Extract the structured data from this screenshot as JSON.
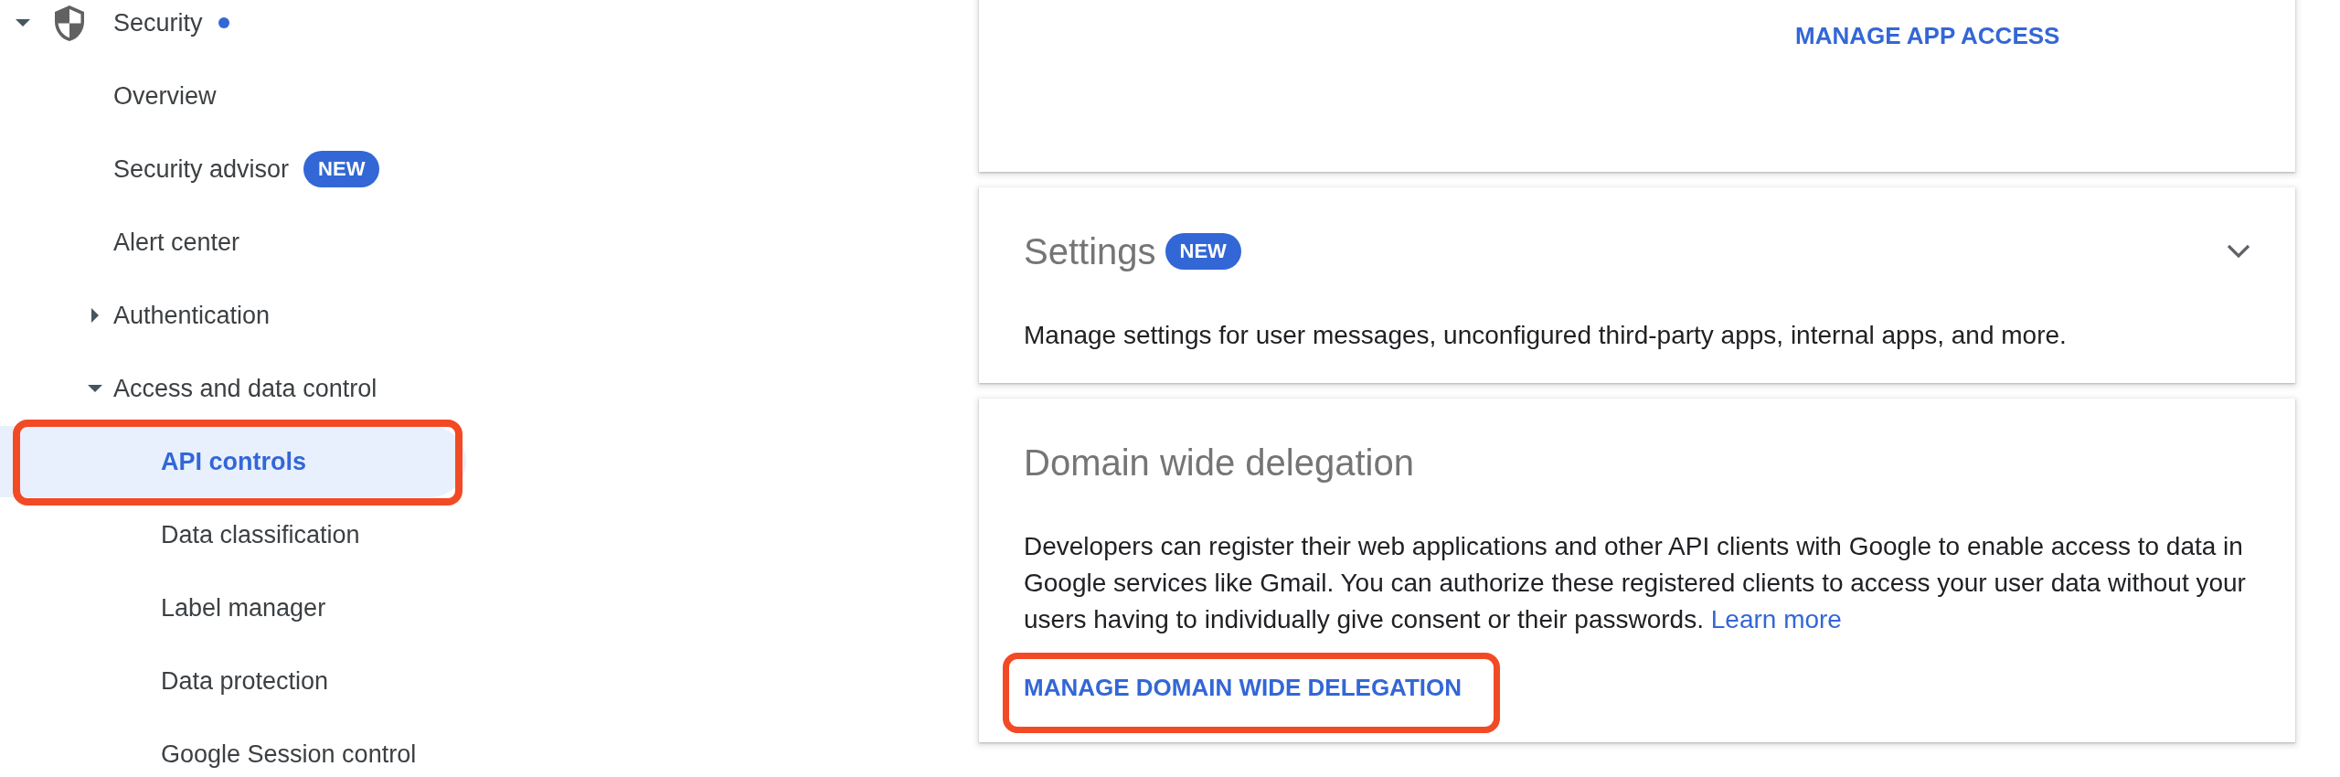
{
  "sidebar": {
    "items": [
      {
        "label": "Security",
        "expanded": true,
        "dot": true,
        "selected": false,
        "outlined": false,
        "children": [
          {
            "label": "Overview",
            "selected": false,
            "outlined": false
          },
          {
            "label": "Security advisor",
            "badge": "NEW",
            "selected": false,
            "outlined": false
          },
          {
            "label": "Alert center",
            "selected": false,
            "outlined": false
          },
          {
            "label": "Authentication",
            "expanded": false,
            "selected": false,
            "outlined": false
          },
          {
            "label": "Access and data control",
            "expanded": true,
            "selected": false,
            "outlined": false,
            "children": [
              {
                "label": "API controls",
                "selected": true,
                "outlined": true
              },
              {
                "label": "Data classification",
                "selected": false,
                "outlined": false
              },
              {
                "label": "Label manager",
                "selected": false,
                "outlined": false
              },
              {
                "label": "Data protection",
                "selected": false,
                "outlined": false
              },
              {
                "label": "Google Session control",
                "selected": false,
                "outlined": false
              }
            ]
          }
        ]
      }
    ]
  },
  "cards": [
    {
      "action": {
        "label": "MANAGE APP ACCESS",
        "outlined": false
      }
    },
    {
      "title": "Settings",
      "badge": "NEW",
      "expanded": false,
      "description": "Manage settings for user messages, unconfigured third-party apps, internal apps, and more."
    },
    {
      "title": "Domain wide delegation",
      "description": "Developers can register their web applications and other API clients with Google to enable access to data in Google services like Gmail. You can authorize these registered clients to access your user data without your users having to individually give consent or their passwords.",
      "link": "Learn more",
      "action": {
        "label": "MANAGE DOMAIN WIDE DELEGATION",
        "outlined": true
      }
    }
  ]
}
